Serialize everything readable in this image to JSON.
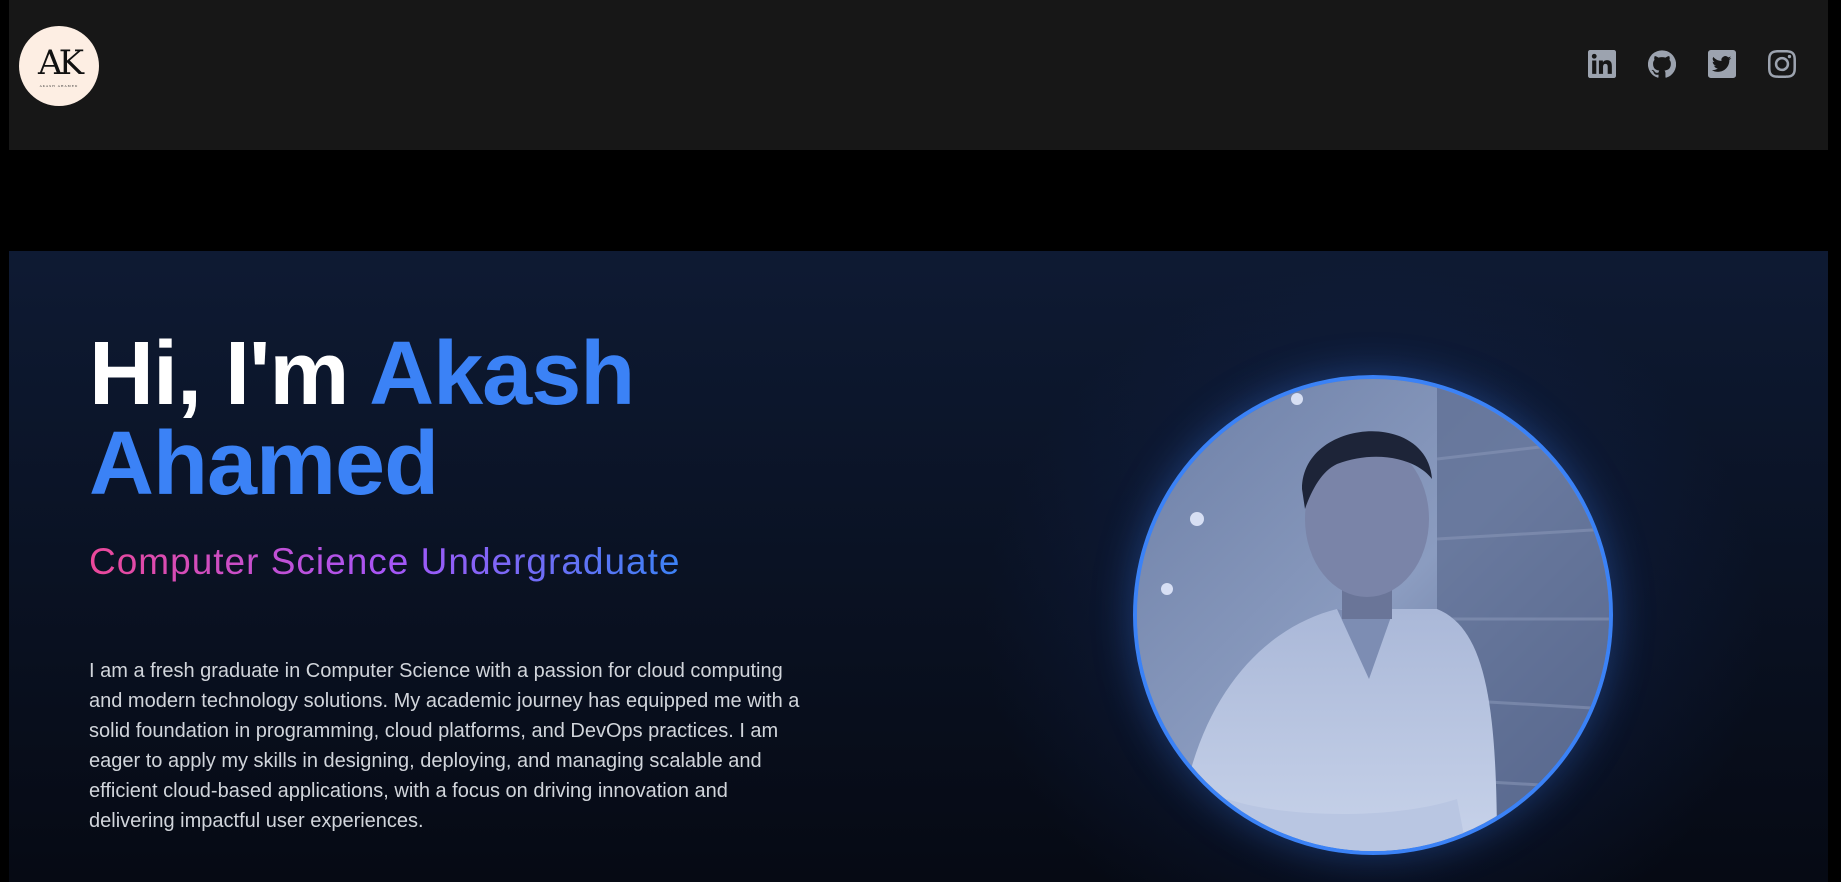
{
  "header": {
    "logo": {
      "monogram": "AK",
      "tagline": "AKASH AHAMED"
    },
    "socials": [
      {
        "name": "linkedin",
        "icon": "linkedin-icon"
      },
      {
        "name": "github",
        "icon": "github-icon"
      },
      {
        "name": "twitter",
        "icon": "twitter-icon"
      },
      {
        "name": "instagram",
        "icon": "instagram-icon"
      }
    ]
  },
  "hero": {
    "greeting": "Hi, I'm ",
    "name_first": "Akash",
    "name_last": "Ahamed",
    "subtitle": "Computer Science Undergraduate",
    "bio": "I am a fresh graduate in Computer Science with a passion for cloud computing and modern technology solutions. My academic journey has equipped me with a solid foundation in programming, cloud platforms, and DevOps practices. I am eager to apply my skills in designing, deploying, and managing scalable and efficient cloud-based applications, with a focus on driving innovation and delivering impactful user experiences."
  },
  "colors": {
    "accent": "#3b82f6",
    "gradient": [
      "#ec4899",
      "#a855f7",
      "#3b82f6"
    ],
    "nav_bg": "#171717",
    "icon": "#9ca3af"
  }
}
